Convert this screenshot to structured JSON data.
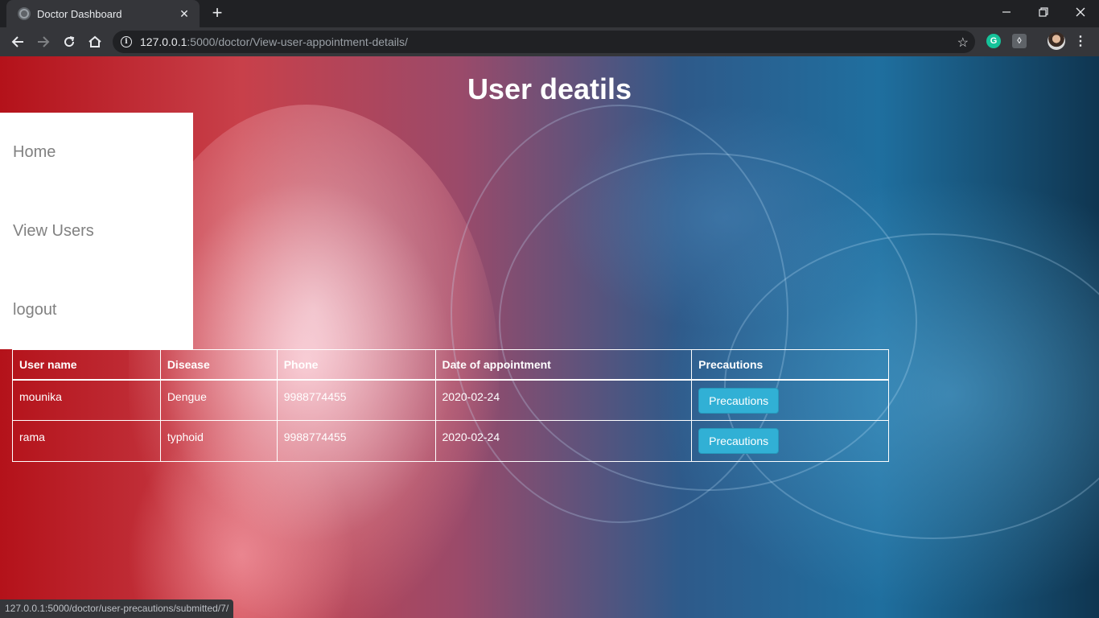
{
  "browser": {
    "tab_title": "Doctor Dashboard",
    "url_host": "127.0.0.1",
    "url_rest": ":5000/doctor/View-user-appointment-details/",
    "status_url": "127.0.0.1:5000/doctor/user-precautions/submitted/7/"
  },
  "page": {
    "title": "User deatils"
  },
  "sidenav": {
    "items": [
      {
        "label": "Home"
      },
      {
        "label": "View Users"
      },
      {
        "label": "logout"
      }
    ]
  },
  "table": {
    "headers": [
      "User name",
      "Disease",
      "Phone",
      "Date of appointment",
      "Precautions"
    ],
    "rows": [
      {
        "user_name": "mounika",
        "disease": "Dengue",
        "phone": "9988774455",
        "date": "2020-02-24",
        "action": "Precautions"
      },
      {
        "user_name": "rama",
        "disease": "typhoid",
        "phone": "9988774455",
        "date": "2020-02-24",
        "action": "Precautions"
      }
    ]
  },
  "colors": {
    "button": "#31b0d5",
    "nav_text": "#818181",
    "chrome_dark": "#202124",
    "chrome_toolbar": "#35363a"
  },
  "icons": [
    "back-icon",
    "forward-icon",
    "reload-icon",
    "home-icon",
    "info-icon",
    "star-icon",
    "grammarly-icon",
    "extension-icon",
    "avatar",
    "menu-icon",
    "minimize-icon",
    "restore-icon",
    "close-icon"
  ]
}
